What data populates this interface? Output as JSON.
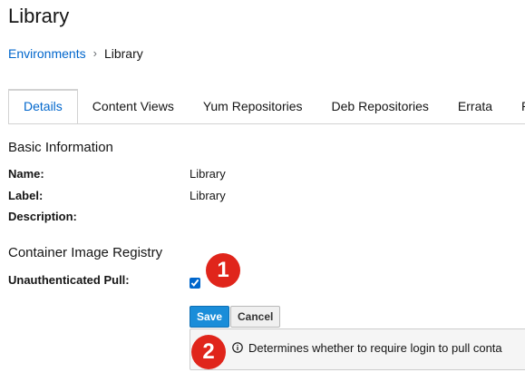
{
  "page": {
    "title": "Library"
  },
  "breadcrumb": {
    "parent": "Environments",
    "separator": "›",
    "current": "Library"
  },
  "tabs": [
    {
      "label": "Details",
      "active": true
    },
    {
      "label": "Content Views",
      "active": false
    },
    {
      "label": "Yum Repositories",
      "active": false
    },
    {
      "label": "Deb Repositories",
      "active": false
    },
    {
      "label": "Errata",
      "active": false
    },
    {
      "label": "Pa",
      "active": false
    }
  ],
  "basic_info": {
    "heading": "Basic Information",
    "name_label": "Name:",
    "name_value": "Library",
    "label_label": "Label:",
    "label_value": "Library",
    "description_label": "Description:",
    "description_value": ""
  },
  "registry": {
    "heading": "Container Image Registry",
    "unauth_pull_label": "Unauthenticated Pull:",
    "unauth_pull_checked": true,
    "save_label": "Save",
    "cancel_label": "Cancel",
    "help_text": "Determines whether to require login to pull conta"
  },
  "annotations": {
    "badge_1": "1",
    "badge_2": "2",
    "badge_color": "#e0251b"
  },
  "colors": {
    "link": "#0066cc",
    "save_button": "#1a8dd9",
    "text": "#151515"
  }
}
